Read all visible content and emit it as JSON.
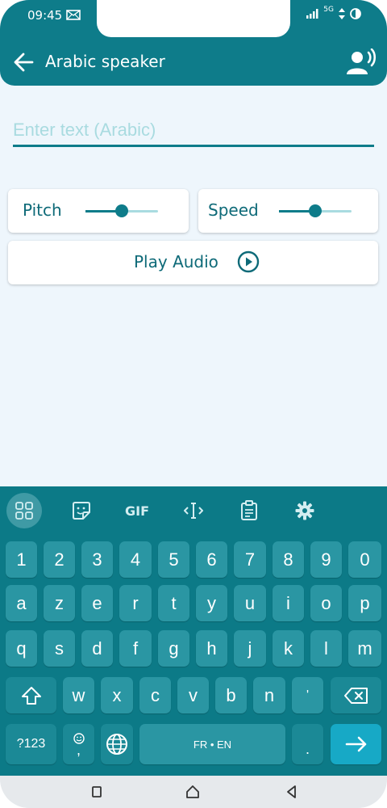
{
  "status": {
    "time": "09:45",
    "network": "5G"
  },
  "header": {
    "title": "Arabic speaker"
  },
  "input": {
    "placeholder": "Enter text (Arabic)"
  },
  "controls": {
    "pitch_label": "Pitch",
    "pitch_value": 0.5,
    "speed_label": "Speed",
    "speed_value": 0.5,
    "play_label": "Play Audio"
  },
  "keyboard": {
    "toolbar": {
      "gif_label": "GIF"
    },
    "row_numbers": [
      "1",
      "2",
      "3",
      "4",
      "5",
      "6",
      "7",
      "8",
      "9",
      "0"
    ],
    "row1": [
      "a",
      "z",
      "e",
      "r",
      "t",
      "y",
      "u",
      "i",
      "o",
      "p"
    ],
    "row2": [
      "q",
      "s",
      "d",
      "f",
      "g",
      "h",
      "j",
      "k",
      "l",
      "m"
    ],
    "row3": [
      "w",
      "x",
      "c",
      "v",
      "b",
      "n",
      "'"
    ],
    "symbols_label": "?123",
    "comma_label": ",",
    "space_label": "FR • EN",
    "period_label": "."
  },
  "colors": {
    "primary": "#0e7c8a",
    "background": "#eef6fc",
    "key": "#2a96a3",
    "enter": "#17a9c6"
  }
}
